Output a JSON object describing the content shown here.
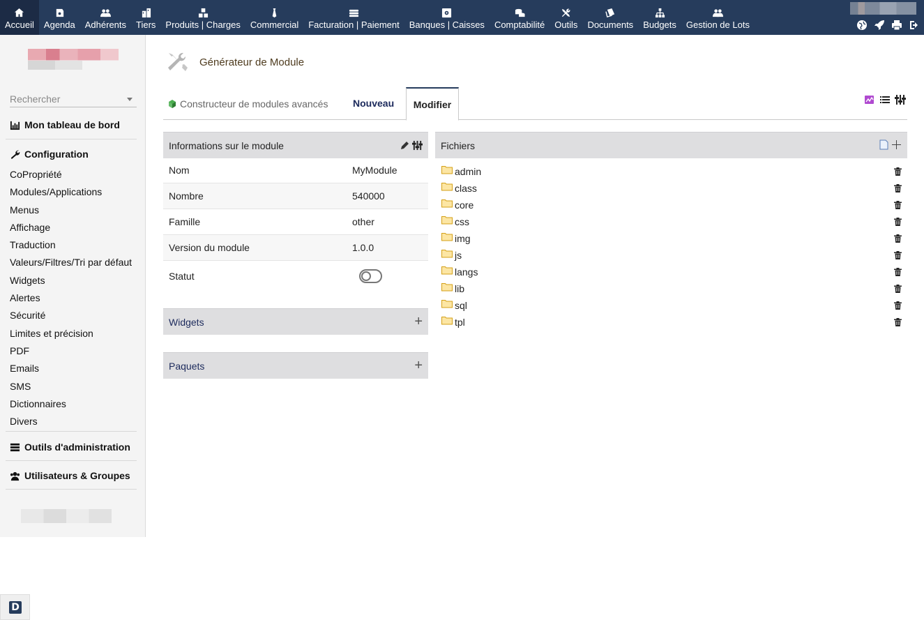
{
  "topmenu": [
    {
      "label": "Accueil",
      "icon": "home-icon",
      "active": true
    },
    {
      "label": "Agenda",
      "icon": "agenda-icon"
    },
    {
      "label": "Adhérents",
      "icon": "members-icon"
    },
    {
      "label": "Tiers",
      "icon": "building-icon"
    },
    {
      "label": "Produits | Charges",
      "icon": "cubes-icon"
    },
    {
      "label": "Commercial",
      "icon": "tie-icon"
    },
    {
      "label": "Facturation | Paiement",
      "icon": "money-icon"
    },
    {
      "label": "Banques | Caisses",
      "icon": "safe-icon"
    },
    {
      "label": "Comptabilité",
      "icon": "coins-icon"
    },
    {
      "label": "Outils",
      "icon": "tools-icon"
    },
    {
      "label": "Documents",
      "icon": "documents-icon"
    },
    {
      "label": "Budgets",
      "icon": "sitemap-icon"
    },
    {
      "label": "Gestion de Lots",
      "icon": "users-icon"
    }
  ],
  "sidebar": {
    "search_placeholder": "Rechercher",
    "dashboard": "Mon tableau de bord",
    "configuration": "Configuration",
    "items": [
      "CoPropriété",
      "Modules/Applications",
      "Menus",
      "Affichage",
      "Traduction",
      "Valeurs/Filtres/Tri par défaut",
      "Widgets",
      "Alertes",
      "Sécurité",
      "Limites et précision",
      "PDF",
      "Emails",
      "SMS",
      "Dictionnaires",
      "Divers"
    ],
    "admin_tools": "Outils d'administration",
    "users_groups": "Utilisateurs & Groupes"
  },
  "page": {
    "title": "Générateur de Module"
  },
  "tabs": {
    "builder": "Constructeur de modules avancés",
    "new": "Nouveau",
    "edit": "Modifier"
  },
  "info": {
    "title": "Informations sur le module",
    "rows": [
      {
        "key": "Nom",
        "value": "MyModule"
      },
      {
        "key": "Nombre",
        "value": "540000"
      },
      {
        "key": "Famille",
        "value": "other"
      },
      {
        "key": "Version du module",
        "value": "1.0.0"
      }
    ],
    "status_label": "Statut",
    "status_enabled": false
  },
  "widgets": {
    "title": "Widgets"
  },
  "packages": {
    "title": "Paquets"
  },
  "files": {
    "title": "Fichiers",
    "items": [
      "admin",
      "class",
      "core",
      "css",
      "img",
      "js",
      "langs",
      "lib",
      "sql",
      "tpl"
    ]
  },
  "colors": {
    "topbar": "#263c5c",
    "link": "#1c2a5c",
    "panel_header": "#dedee0"
  }
}
